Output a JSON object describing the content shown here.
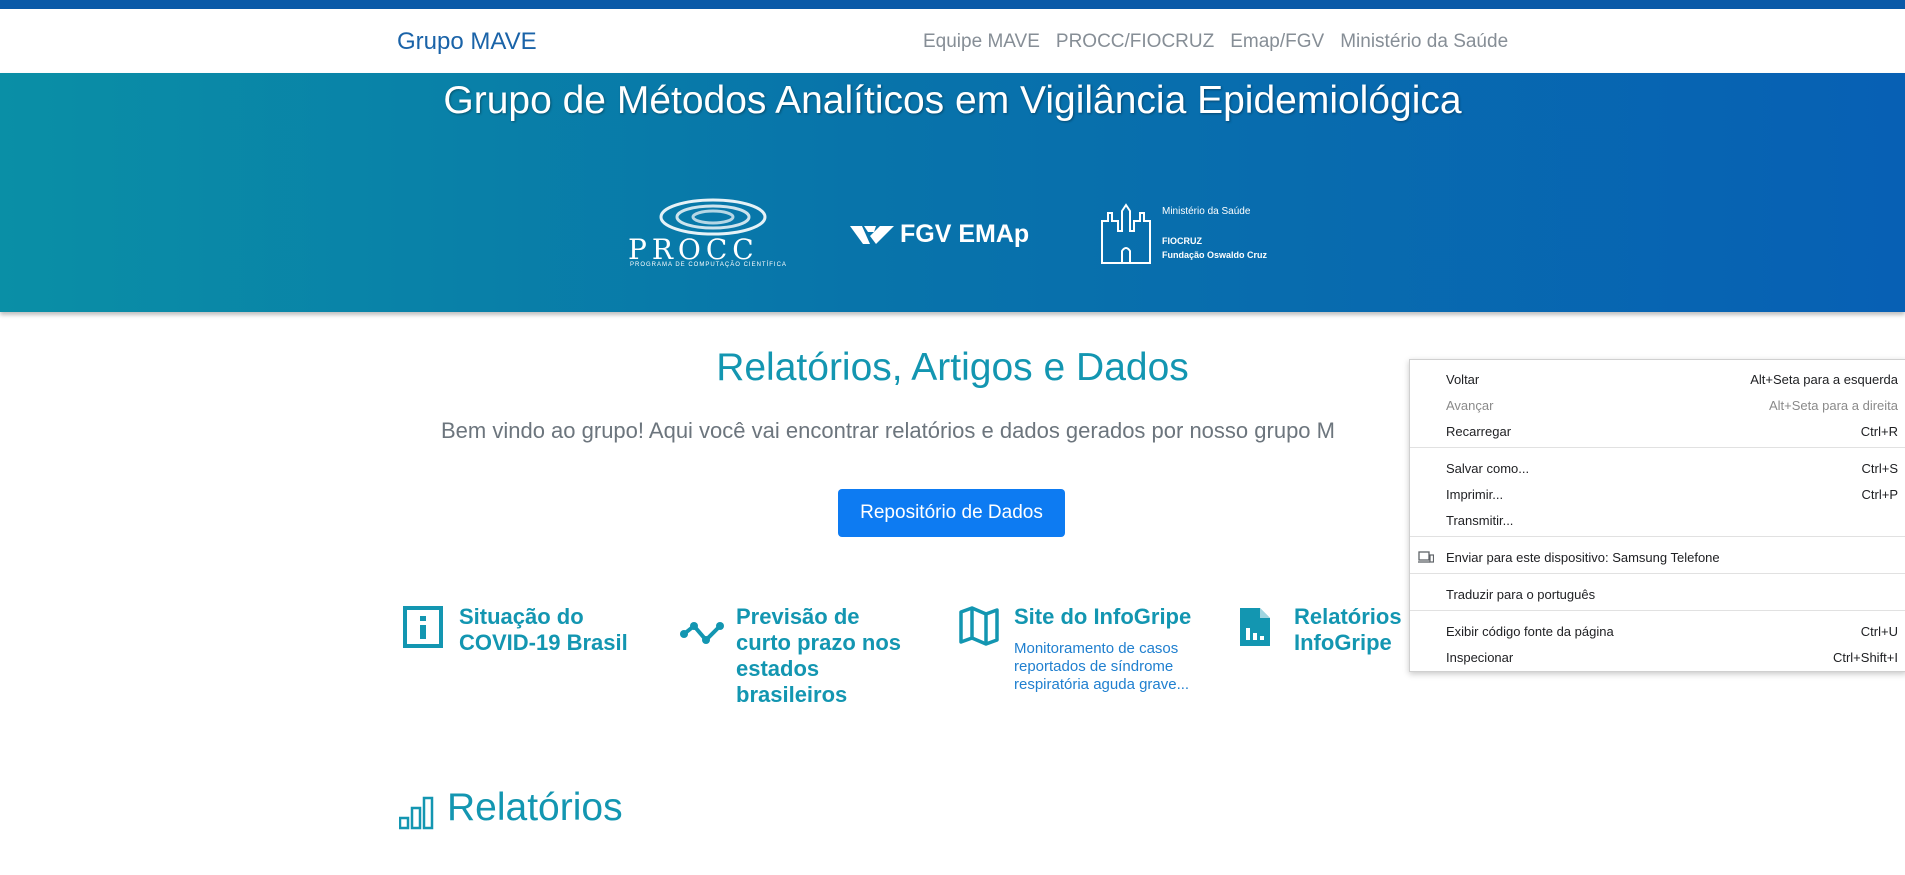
{
  "navbar": {
    "brand": "Grupo MAVE",
    "links": [
      "Equipe MAVE",
      "PROCC/FIOCRUZ",
      "Emap/FGV",
      "Ministério da Saúde"
    ]
  },
  "hero": {
    "title": "Grupo de Métodos Analíticos em Vigilância Epidemiológica",
    "logos": {
      "procc": {
        "word": "PROCC",
        "sub": "PROGRAMA DE COMPUTAÇÃO CIENTÍFICA"
      },
      "fgv": {
        "text": "FGV EMAp"
      },
      "fiocruz": {
        "ministry": "Ministério da Saúde",
        "name": "FIOCRUZ",
        "full": "Fundação Oswaldo Cruz"
      }
    }
  },
  "main": {
    "title": "Relatórios, Artigos e Dados",
    "welcome": "Bem vindo ao grupo! Aqui você vai encontrar relatórios e dados gerados por nosso grupo M",
    "repo_button": "Repositório de Dados",
    "cards": [
      {
        "title_lines": [
          "Situação do",
          "COVID-19 Brasil"
        ],
        "icon": "info-icon"
      },
      {
        "title_lines": [
          "Previsão de",
          "curto prazo nos",
          "estados",
          "brasileiros"
        ],
        "icon": "trend-icon"
      },
      {
        "title_lines": [
          "Site do InfoGripe"
        ],
        "desc_lines": [
          "Monitoramento de casos",
          "reportados de síndrome",
          "respiratória aguda grave..."
        ],
        "icon": "map-icon"
      },
      {
        "title_lines": [
          "Relatórios",
          "InfoGripe"
        ],
        "icon": "chart-file-icon"
      }
    ],
    "reports_heading": "Relatórios"
  },
  "context_menu": {
    "items": [
      {
        "label": "Voltar",
        "shortcut": "Alt+Seta para a esquerda",
        "enabled": true
      },
      {
        "label": "Avançar",
        "shortcut": "Alt+Seta para a direita",
        "enabled": false
      },
      {
        "label": "Recarregar",
        "shortcut": "Ctrl+R",
        "enabled": true
      },
      {
        "label": "Salvar como...",
        "shortcut": "Ctrl+S",
        "enabled": true
      },
      {
        "label": "Imprimir...",
        "shortcut": "Ctrl+P",
        "enabled": true
      },
      {
        "label": "Transmitir...",
        "shortcut": "",
        "enabled": true
      },
      {
        "label": "Enviar para este dispositivo: Samsung Telefone",
        "shortcut": "",
        "enabled": true,
        "icon": "devices-icon"
      },
      {
        "label": "Traduzir para o português",
        "shortcut": "",
        "enabled": true
      },
      {
        "label": "Exibir código fonte da página",
        "shortcut": "Ctrl+U",
        "enabled": true
      },
      {
        "label": "Inspecionar",
        "shortcut": "Ctrl+Shift+I",
        "enabled": true
      }
    ]
  },
  "colors": {
    "brand": "#1a63a8",
    "accent": "#1396b1",
    "button": "#0d7bf2",
    "hero_start": "#0a8fa6",
    "hero_end": "#0760b4"
  }
}
